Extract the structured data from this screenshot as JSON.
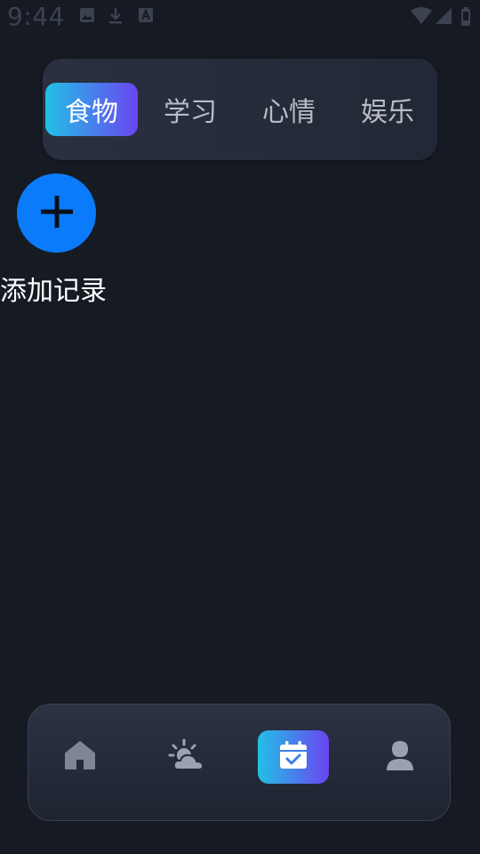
{
  "status_bar": {
    "time": "9:44",
    "icons": [
      "image-icon",
      "download-icon",
      "a-icon",
      "wifi-icon",
      "signal-icon",
      "battery-icon"
    ]
  },
  "tabs": {
    "items": [
      {
        "label": "食物",
        "active": true
      },
      {
        "label": "学习",
        "active": false
      },
      {
        "label": "心情",
        "active": false
      },
      {
        "label": "娱乐",
        "active": false
      }
    ]
  },
  "add_record": {
    "label": "添加记录",
    "icon": "plus-icon"
  },
  "bottom_nav": {
    "items": [
      "home-icon",
      "weather-icon",
      "calendar-check-icon",
      "profile-icon"
    ],
    "active_index": 2
  },
  "colors": {
    "background": "#161a23",
    "accent_gradient_start": "#22c0e6",
    "accent_gradient_end": "#6a45f0",
    "add_button": "#0a7bfb"
  }
}
